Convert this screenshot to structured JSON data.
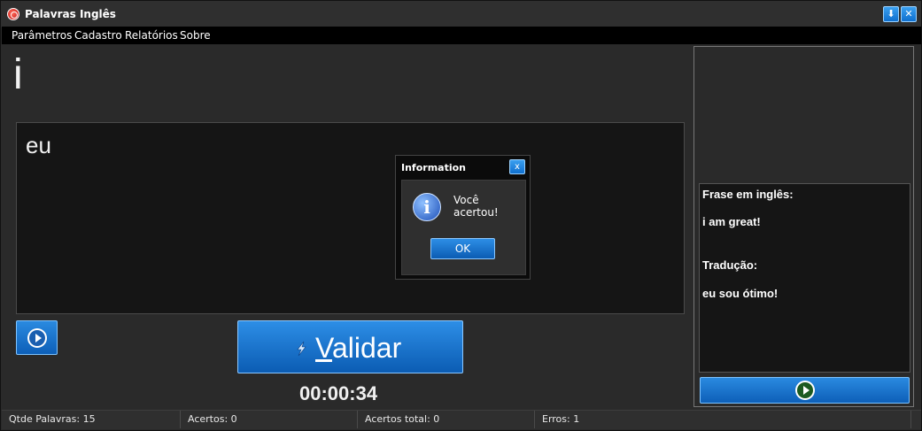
{
  "app": {
    "title": "Palavras Inglês",
    "minimize_icon": "⬇",
    "close_icon": "✕"
  },
  "menu": [
    {
      "label": "Parâmetros"
    },
    {
      "label": "Cadastro"
    },
    {
      "label": "Relatórios"
    },
    {
      "label": "Sobre"
    }
  ],
  "main": {
    "word": "i",
    "answer": "eu",
    "validate_prefix": "",
    "validate_underlined": "V",
    "validate_rest": "alidar",
    "timer": "00:00:34"
  },
  "side_panel": {
    "phrase_label": "Frase em inglês:",
    "phrase": "i am great!",
    "translation_label": "Tradução:",
    "translation": "eu sou ótimo!"
  },
  "status": {
    "qtde": "Qtde Palavras: 15",
    "acertos": "Acertos: 0",
    "acertos_total": "Acertos total: 0",
    "erros": "Erros: 1"
  },
  "dialog": {
    "title": "Information",
    "close_icon": "x",
    "icon_glyph": "i",
    "message": "Você acertou!",
    "ok_label": "OK"
  },
  "colors": {
    "accent": "#1a7ad8",
    "background": "#2a2a2a",
    "text_box": "#151515"
  }
}
